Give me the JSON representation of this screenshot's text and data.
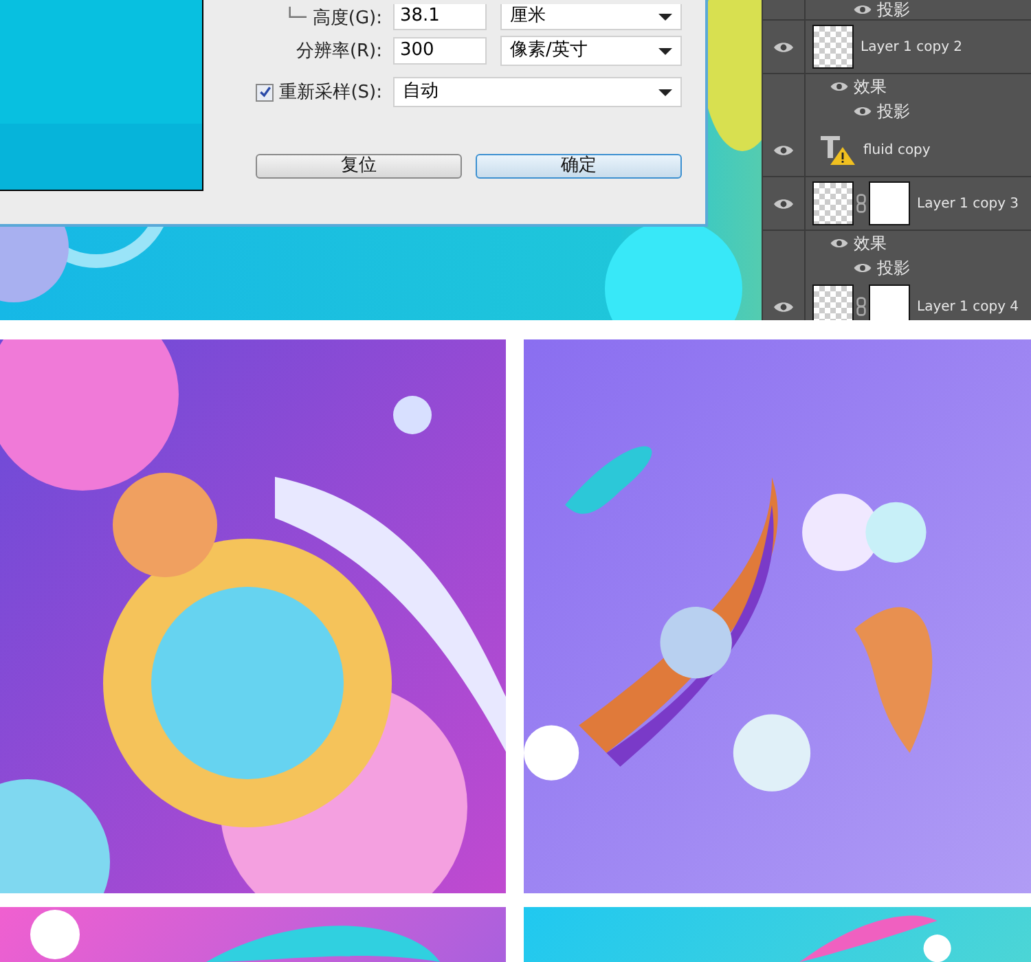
{
  "dialog": {
    "fields": [
      {
        "label": "高度(G):",
        "value": "38.1",
        "unit": "厘米",
        "linked": true
      },
      {
        "label": "分辨率(R):",
        "value": "300",
        "unit": "像素/英寸",
        "linked": false
      }
    ],
    "resample": {
      "label": "重新采样(S):",
      "checked": true,
      "value": "自动"
    },
    "buttons": [
      {
        "label": "复位",
        "selected": false
      },
      {
        "label": "确定",
        "selected": true
      }
    ]
  },
  "layers": [
    {
      "kind": "fx",
      "label": "投影"
    },
    {
      "kind": "image-layer",
      "name": "Layer 1 copy 2",
      "mask": false
    },
    {
      "kind": "fx-header",
      "label": "效果"
    },
    {
      "kind": "fx",
      "label": "投影"
    },
    {
      "kind": "text-layer",
      "name": "fluid copy",
      "warning": true
    },
    {
      "kind": "image-layer",
      "name": "Layer 1 copy 3",
      "mask": true
    },
    {
      "kind": "fx-header",
      "label": "效果"
    },
    {
      "kind": "fx",
      "label": "投影"
    },
    {
      "kind": "image-layer",
      "name": "Layer 1 copy 4",
      "mask": true
    }
  ]
}
